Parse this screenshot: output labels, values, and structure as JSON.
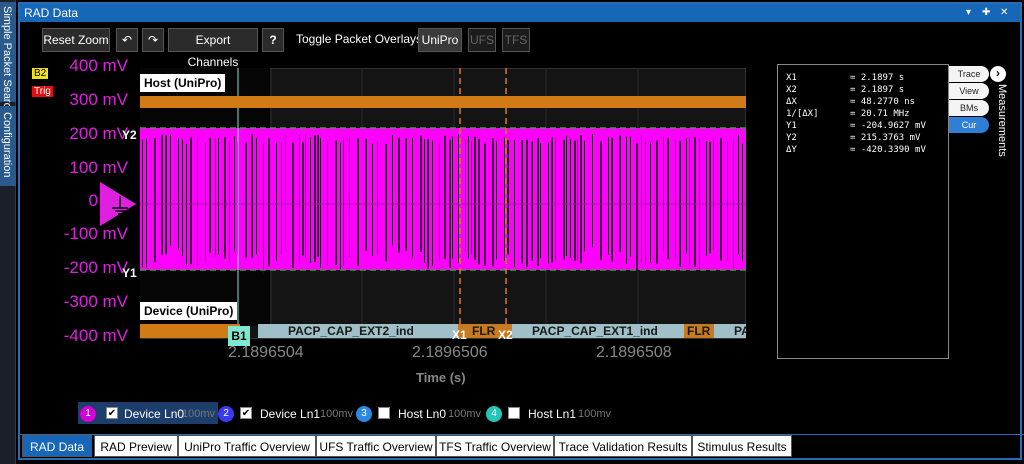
{
  "rail": {
    "tab1": "Simple Packet Search",
    "tab2": "Configuration"
  },
  "window": {
    "title": "RAD Data",
    "controls": [
      "▾",
      "✚",
      "✕"
    ]
  },
  "toolbar": {
    "reset_zoom": "Reset Zoom",
    "undo_icon": "↶",
    "redo_icon": "↷",
    "export_channels": "Export Channels",
    "help": "?",
    "toggle_label": "Toggle Packet Overlays:",
    "overlays": [
      {
        "label": "UniPro",
        "active": true
      },
      {
        "label": "UFS",
        "active": false
      },
      {
        "label": "TFS",
        "active": false
      }
    ]
  },
  "badges": {
    "b2": "B2",
    "trig": "Trig"
  },
  "plot": {
    "y_ticks": [
      "400 mV",
      "300 mV",
      "200 mV",
      "100 mV",
      "0",
      "-100 mV",
      "-200 mV",
      "-300 mV",
      "-400 mV"
    ],
    "x_ticks": [
      "2.1896504",
      "2.1896506",
      "2.1896508"
    ],
    "x_axis_label": "Time (s)",
    "host_label": "Host (UniPro)",
    "device_label": "Device (UniPro)",
    "y_cursor_labels": {
      "y1": "Y1",
      "y2": "Y2"
    },
    "x_cursor_labels": {
      "x1": "X1",
      "x2": "X2",
      "b1": "B1"
    },
    "decode_segments": [
      {
        "text": "PACP_CAP_EXT2_ind",
        "kind": "packet"
      },
      {
        "text": "FLR",
        "kind": "flr"
      },
      {
        "text": "PACP_CAP_EXT1_ind",
        "kind": "packet"
      },
      {
        "text": "FLR",
        "kind": "flr"
      },
      {
        "text": "PA",
        "kind": "packet"
      }
    ],
    "colors": {
      "signal": "#ff00ff",
      "band": "#d27a16",
      "cursor": "#e07a20",
      "marker": "#7fe6cf"
    }
  },
  "measurements": {
    "rows": [
      {
        "k": "X1",
        "v": "= 2.1897 s"
      },
      {
        "k": "X2",
        "v": "= 2.1897 s"
      },
      {
        "k": "ΔX",
        "v": "= 48.2770 ns"
      },
      {
        "k": "1/[ΔX]",
        "v": "= 20.71 MHz"
      },
      {
        "k": "Y1",
        "v": "= -204.9627 mV"
      },
      {
        "k": "Y2",
        "v": "= 215.3763 mV"
      },
      {
        "k": "ΔY",
        "v": "= -420.3390 mV"
      }
    ],
    "tabs": [
      {
        "label": "Trace",
        "active": false
      },
      {
        "label": "View",
        "active": false
      },
      {
        "label": "BMs",
        "active": false
      },
      {
        "label": "Cur",
        "active": true
      }
    ],
    "side_label": "Measurements",
    "expand_icon": "›"
  },
  "channels": [
    {
      "num": "1",
      "name": "Device Ln0",
      "scale": "100mv",
      "checked": true,
      "color": "#d400d4"
    },
    {
      "num": "2",
      "name": "Device Ln1",
      "scale": "100mv",
      "checked": true,
      "color": "#3a3af0"
    },
    {
      "num": "3",
      "name": "Host Ln0",
      "scale": "100mv",
      "checked": false,
      "color": "#2a8be0"
    },
    {
      "num": "4",
      "name": "Host Ln1",
      "scale": "100mv",
      "checked": false,
      "color": "#22c7b5"
    }
  ],
  "bottom_tabs": [
    {
      "label": "RAD Data",
      "active": true
    },
    {
      "label": "RAD Preview",
      "active": false
    },
    {
      "label": "UniPro Traffic Overview",
      "active": false
    },
    {
      "label": "UFS Traffic Overview",
      "active": false
    },
    {
      "label": "TFS Traffic Overview",
      "active": false
    },
    {
      "label": "Trace Validation Results",
      "active": false
    },
    {
      "label": "Stimulus Results",
      "active": false
    }
  ]
}
